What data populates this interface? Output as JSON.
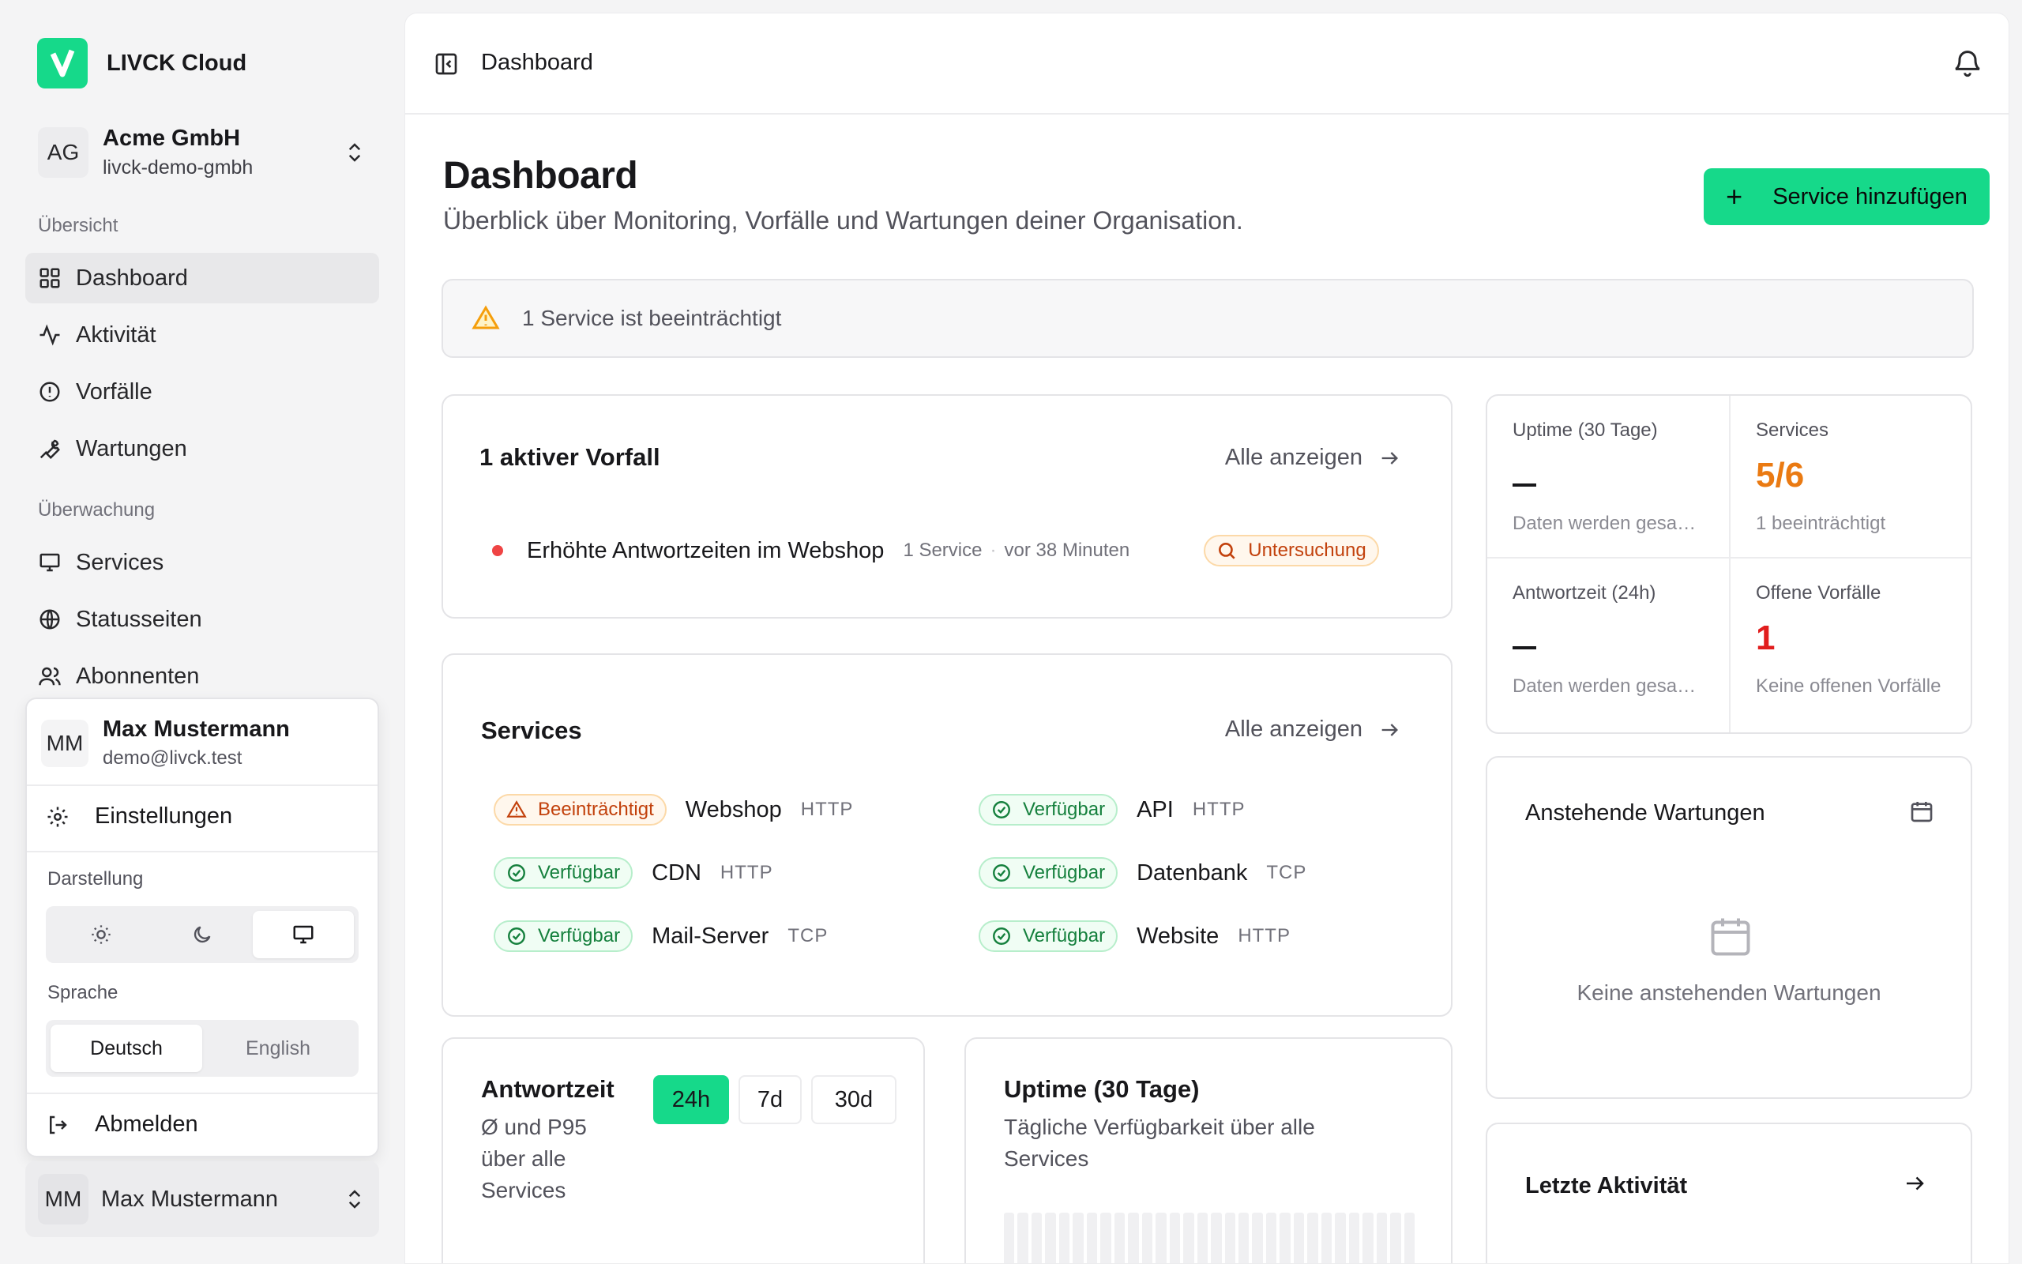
{
  "brand": {
    "name": "LIVCK Cloud",
    "color": "#16d98a"
  },
  "org": {
    "initials": "AG",
    "name": "Acme GmbH",
    "slug": "livck-demo-gmbh"
  },
  "nav": {
    "section_overview": "Übersicht",
    "section_monitoring": "Überwachung",
    "dashboard": "Dashboard",
    "activity": "Aktivität",
    "incidents": "Vorfälle",
    "maintenance": "Wartungen",
    "services": "Services",
    "status_pages": "Statusseiten",
    "subscribers": "Abonnenten"
  },
  "user_menu": {
    "initials": "MM",
    "name": "Max Mustermann",
    "email": "demo@livck.test",
    "settings": "Einstellungen",
    "appearance_label": "Darstellung",
    "appearance_options": [
      "sun-icon",
      "moon-icon",
      "monitor-icon"
    ],
    "appearance_selected": "monitor-icon",
    "language_label": "Sprache",
    "lang_de": "Deutsch",
    "lang_en": "English",
    "language_selected": "Deutsch",
    "logout": "Abmelden"
  },
  "user_footer": {
    "initials": "MM",
    "name": "Max Mustermann"
  },
  "topbar": {
    "title": "Dashboard"
  },
  "page": {
    "title": "Dashboard",
    "subtitle": "Überblick über Monitoring, Vorfälle und Wartungen deiner Organisation.",
    "add_service": "Service hinzufügen",
    "alert": "1 Service ist beeinträchtigt"
  },
  "incidents_card": {
    "title": "1 aktiver Vorfall",
    "link": "Alle anzeigen",
    "items": [
      {
        "title": "Erhöhte Antwortzeiten im Webshop",
        "services": "1 Service",
        "time": "vor 38 Minuten",
        "status": "Untersuchung"
      }
    ]
  },
  "services_card": {
    "title": "Services",
    "link": "Alle anzeigen",
    "items": [
      {
        "status": "Beeinträchtigt",
        "name": "Webshop",
        "type": "HTTP"
      },
      {
        "status": "Verfügbar",
        "name": "API",
        "type": "HTTP"
      },
      {
        "status": "Verfügbar",
        "name": "CDN",
        "type": "HTTP"
      },
      {
        "status": "Verfügbar",
        "name": "Datenbank",
        "type": "TCP"
      },
      {
        "status": "Verfügbar",
        "name": "Mail-Server",
        "type": "TCP"
      },
      {
        "status": "Verfügbar",
        "name": "Website",
        "type": "HTTP"
      }
    ]
  },
  "stats": {
    "uptime": {
      "label": "Uptime (30 Tage)",
      "sub": "Daten werden gesammelt"
    },
    "services": {
      "label": "Services",
      "value": "5/6",
      "sub": "1 beeinträchtigt",
      "color": "#ea7a12"
    },
    "response": {
      "label": "Antwortzeit (24h)",
      "sub": "Daten werden gesammelt"
    },
    "open_incidents": {
      "label": "Offene Vorfälle",
      "value": "1",
      "sub": "Keine offenen Vorfälle",
      "color": "#e11d1d"
    }
  },
  "maintenance_card": {
    "title": "Anstehende Wartungen",
    "empty": "Keine anstehenden Wartungen"
  },
  "response_card": {
    "title": "Antwortzeit",
    "subtitle_l1": "Ø und P95",
    "subtitle_l2": "über alle",
    "subtitle_l3": "Services",
    "ranges": [
      "24h",
      "7d",
      "30d"
    ],
    "selected_range": "24h"
  },
  "uptime_card": {
    "title": "Uptime (30 Tage)",
    "subtitle_l1": "Tägliche Verfügbarkeit über alle",
    "subtitle_l2": "Services"
  },
  "activity_card": {
    "title": "Letzte Aktivität"
  }
}
